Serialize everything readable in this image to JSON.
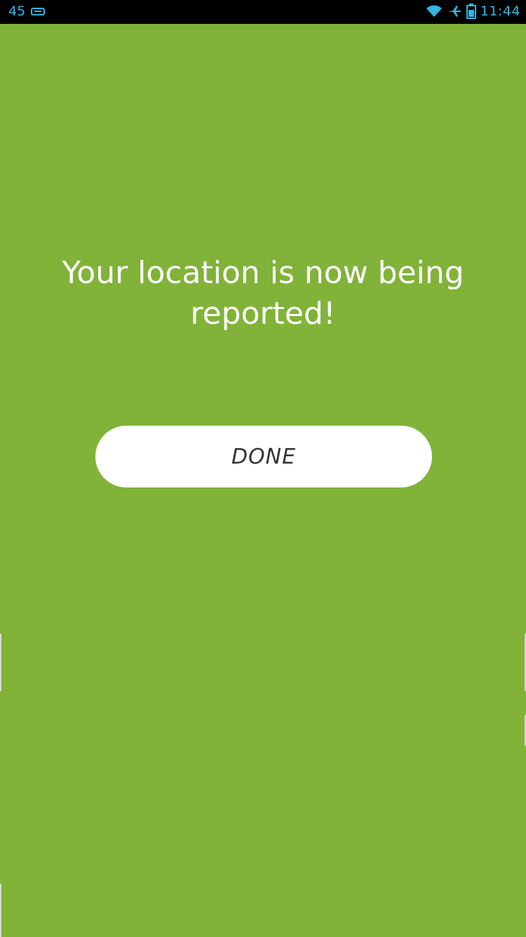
{
  "status_bar": {
    "left_number": "45",
    "time": "11:44",
    "icons": [
      "notification-icon",
      "wifi-icon",
      "airplane-mode-icon",
      "battery-icon"
    ]
  },
  "main": {
    "message": "Your location is now being reported!",
    "done_label": "DONE"
  },
  "colors": {
    "background": "#80b338",
    "button_bg": "#ffffff",
    "button_text": "#333333",
    "status_bar_bg": "#000000",
    "status_text": "#33b5e5"
  }
}
